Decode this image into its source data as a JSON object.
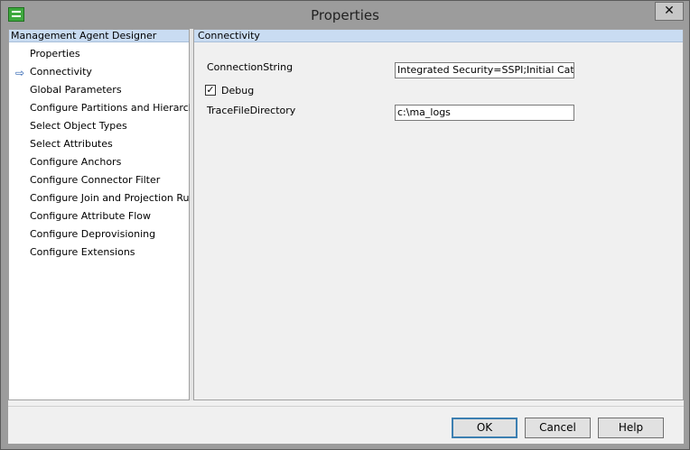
{
  "window": {
    "title": "Properties",
    "close_label": "✕"
  },
  "left_pane": {
    "header": "Management Agent Designer",
    "items": [
      {
        "label": "Properties",
        "selected": false
      },
      {
        "label": "Connectivity",
        "selected": true
      },
      {
        "label": "Global Parameters",
        "selected": false
      },
      {
        "label": "Configure Partitions and Hierarchies",
        "selected": false
      },
      {
        "label": "Select Object Types",
        "selected": false
      },
      {
        "label": "Select Attributes",
        "selected": false
      },
      {
        "label": "Configure Anchors",
        "selected": false
      },
      {
        "label": "Configure Connector Filter",
        "selected": false
      },
      {
        "label": "Configure Join and Projection Rules",
        "selected": false
      },
      {
        "label": "Configure Attribute Flow",
        "selected": false
      },
      {
        "label": "Configure Deprovisioning",
        "selected": false
      },
      {
        "label": "Configure Extensions",
        "selected": false
      }
    ]
  },
  "right_pane": {
    "header": "Connectivity",
    "connection_string_label": "ConnectionString",
    "connection_string_value": "Integrated Security=SSPI;Initial Catalog=F",
    "debug_label": "Debug",
    "debug_checked": true,
    "trace_dir_label": "TraceFileDirectory",
    "trace_dir_value": "c:\\ma_logs"
  },
  "buttons": {
    "ok": "OK",
    "cancel": "Cancel",
    "help": "Help"
  },
  "colors": {
    "pane_header": "#c9dcf2",
    "arrow": "#2a5fb0",
    "default_button_border": "#3c7fb1"
  },
  "icons": {
    "app": "app-icon",
    "close": "close-icon",
    "selection_arrow": "arrow-right-icon",
    "checkmark": "checkmark-icon"
  }
}
